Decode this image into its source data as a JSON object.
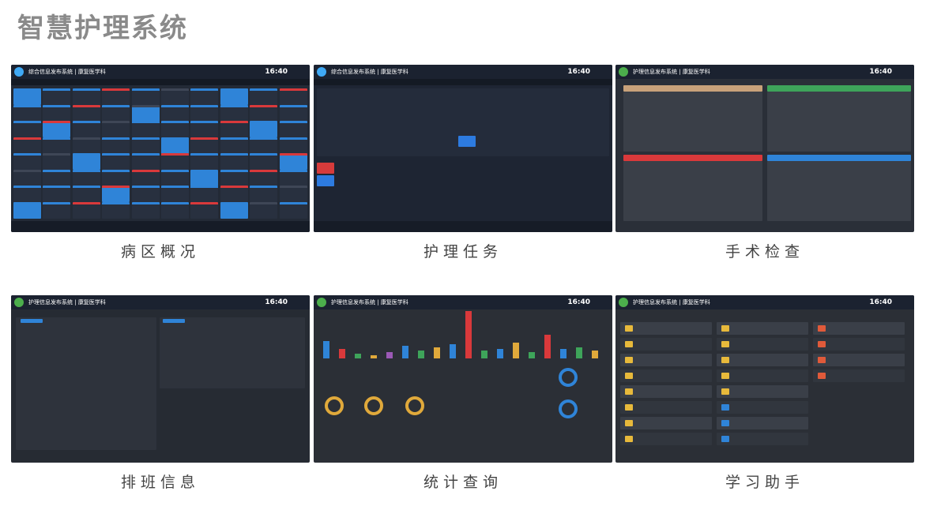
{
  "page_title": "智慧护理系统",
  "cards": [
    {
      "caption": "病区概况",
      "app_title": "综合信息发布系统",
      "dept": "康复医学科",
      "time": "16:40"
    },
    {
      "caption": "护理任务",
      "app_title": "综合信息发布系统",
      "dept": "康复医学科",
      "time": "16:40"
    },
    {
      "caption": "手术检查",
      "app_title": "护理信息发布系统",
      "dept": "康复医学科",
      "time": "16:40"
    },
    {
      "caption": "排班信息",
      "app_title": "护理信息发布系统",
      "dept": "康复医学科",
      "time": "16:40"
    },
    {
      "caption": "统计查询",
      "app_title": "护理信息发布系统",
      "dept": "康复医学科",
      "time": "16:40"
    },
    {
      "caption": "学习助手",
      "app_title": "护理信息发布系统",
      "dept": "康复医学科",
      "time": "16:40"
    }
  ],
  "colors": {
    "accent": "#3fa9f5",
    "dark_bg": "#232a36",
    "header_bg": "#1b2230"
  }
}
